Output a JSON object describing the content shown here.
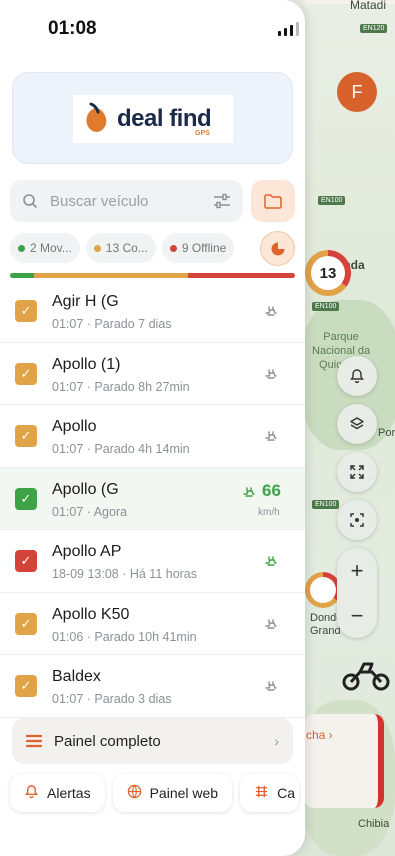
{
  "status": {
    "time": "01:08"
  },
  "map": {
    "labels": {
      "top": "Matadi",
      "city": "Inda",
      "park": "Parque\nNacional da\nQuiçama",
      "town": "Porto",
      "dondo": "Dondo",
      "grand": "Grand",
      "chibia": "Chibia"
    },
    "road_badges": [
      "EN120",
      "EN100",
      "EN100",
      "EN100"
    ],
    "cluster_count": "13",
    "avatar_letter": "F",
    "card_label": "cha ›"
  },
  "logo": {
    "brand": "deal find",
    "tagline": "GPS"
  },
  "search": {
    "placeholder": "Buscar veículo"
  },
  "filters": [
    {
      "label": "2 Mov...",
      "color": "#3da346"
    },
    {
      "label": "13 Co...",
      "color": "#e0a348"
    },
    {
      "label": "9 Offline",
      "color": "#d4433a"
    }
  ],
  "status_distribution": [
    {
      "status": "Movendo",
      "count": 2,
      "color": "#3da346"
    },
    {
      "status": "Conectado",
      "count": 13,
      "color": "#e0a348"
    },
    {
      "status": "Offline",
      "count": 9,
      "color": "#d4433a"
    }
  ],
  "vehicles": [
    {
      "name": "Agir H (G",
      "time": "01:07",
      "status": "Parado 7 dias",
      "color": "#e0a348",
      "moving": false
    },
    {
      "name": "Apollo (1)",
      "time": "01:07",
      "status": "Parado 8h 27min",
      "color": "#e0a348",
      "moving": false
    },
    {
      "name": "Apollo",
      "time": "01:07",
      "status": "Parado 4h 14min",
      "color": "#e0a348",
      "moving": false
    },
    {
      "name": "Apollo (G",
      "time": "01:07",
      "status": "Agora",
      "color": "#3da346",
      "moving": true,
      "speed": "66",
      "unit": "km/h"
    },
    {
      "name": "Apollo AP",
      "time": "18-09 13:08",
      "status": "Há 11 horas",
      "color": "#d4433a",
      "moving": false,
      "ign_on": true
    },
    {
      "name": "Apollo K50",
      "time": "01:06",
      "status": "Parado 10h 41min",
      "color": "#e0a348",
      "moving": false
    },
    {
      "name": "Baldex",
      "time": "01:07",
      "status": "Parado 3 dias",
      "color": "#e0a348",
      "moving": false
    }
  ],
  "panel": {
    "label": "Painel completo"
  },
  "bottom_actions": [
    {
      "label": "Alertas",
      "icon": "bell-icon"
    },
    {
      "label": "Painel web",
      "icon": "globe-icon"
    },
    {
      "label": "Ca",
      "icon": "grid-icon"
    }
  ]
}
